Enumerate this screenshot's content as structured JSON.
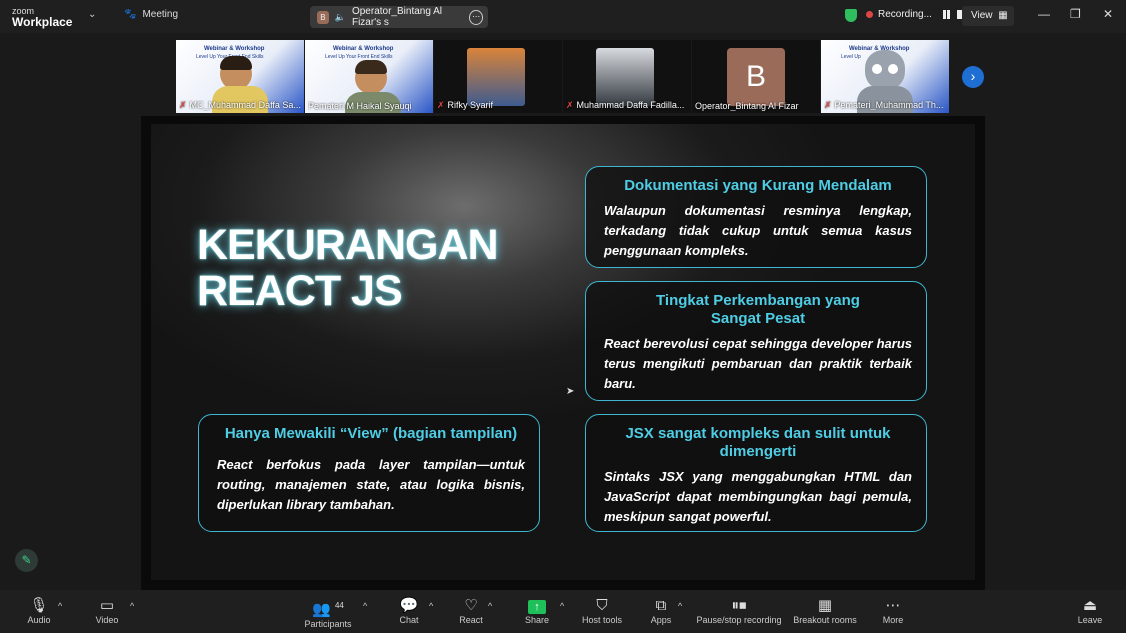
{
  "app": {
    "logo_line1": "zoom",
    "logo_line2": "Workplace",
    "meeting_tab": "Meeting"
  },
  "share_pill": {
    "avatar_letter": "B",
    "text": "Operator_Bintang Al Fizar's s"
  },
  "recording": {
    "label": "Recording..."
  },
  "view": {
    "label": "View"
  },
  "participants_strip": [
    {
      "name": "MC_Muhammad Daffa Sa...",
      "muted": true,
      "active": false,
      "banner_title": "Webinar & Workshop",
      "banner_sub": "Level Up Your Front End Skills"
    },
    {
      "name": "Pemateri M Haikal Syauqi",
      "muted": false,
      "active": true,
      "banner_title": "Webinar & Workshop",
      "banner_sub": "Level Up Your Front End Skills"
    },
    {
      "name": "Rifky Syarif",
      "muted": true,
      "active": false
    },
    {
      "name": "Muhammad Daffa Fadilla...",
      "muted": true,
      "active": false
    },
    {
      "name": "Operator_Bintang Al Fizar",
      "muted": false,
      "active": false,
      "avatar_letter": "B"
    },
    {
      "name": "Pemateri_Muhammad Th...",
      "muted": true,
      "active": false,
      "banner_title": "Webinar & Workshop",
      "banner_sub": "Level Up"
    }
  ],
  "slide": {
    "title_line1": "KEKURANGAN",
    "title_line2": "REACT JS",
    "cards": [
      {
        "heading": "Dokumentasi yang Kurang Mendalam",
        "body": "Walaupun dokumentasi resminya lengkap, terkadang tidak cukup untuk semua kasus penggunaan kompleks."
      },
      {
        "heading": "Tingkat Perkembangan yang Sangat Pesat",
        "body": "React berevolusi cepat sehingga developer harus terus mengikuti pembaruan dan praktik terbaik baru."
      },
      {
        "heading": "Hanya Mewakili “View” (bagian tampilan)",
        "body": "React berfokus pada layer tampilan—untuk routing, manajemen state, atau logika bisnis, diperlukan library tambahan."
      },
      {
        "heading": "JSX sangat kompleks dan sulit untuk dimengerti",
        "body": "Sintaks JSX yang menggabungkan HTML dan JavaScript dapat membingungkan bagi pemula, meskipun sangat powerful."
      }
    ]
  },
  "toolbar": {
    "audio": "Audio",
    "video": "Video",
    "participants": "Participants",
    "participants_count": "44",
    "chat": "Chat",
    "react": "React",
    "share": "Share",
    "host_tools": "Host tools",
    "apps": "Apps",
    "pause_stop": "Pause/stop recording",
    "breakout": "Breakout rooms",
    "more": "More",
    "leave": "Leave"
  },
  "colors": {
    "accent_green": "#33d17a",
    "slide_heading": "#4ecde4",
    "card_border": "#3fb6cf",
    "leave_red": "#e04545"
  }
}
